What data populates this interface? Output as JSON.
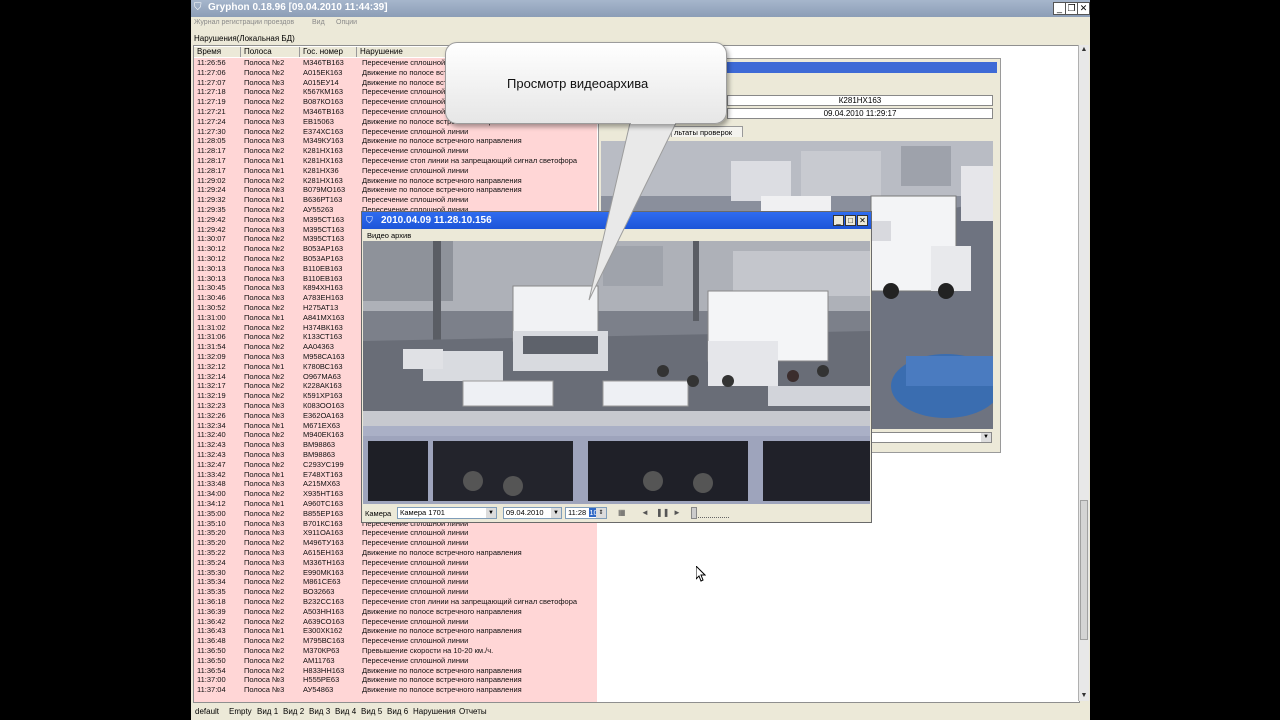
{
  "window": {
    "title": "Gryphon 0.18.96 [09.04.2010 11:44:39]",
    "controls": [
      "_",
      "❐",
      "✕"
    ]
  },
  "menu": [
    "Журнал регистрации проездов",
    "Вид",
    "Опции"
  ],
  "panel_title": "Нарушения(Локальная БД)",
  "columns": [
    "Время",
    "Полоса",
    "Гос. номер",
    "Нарушение"
  ],
  "rows": [
    [
      "11:26:56",
      "Полоса №2",
      "М346ТВ163",
      "Пересечение сплошной линии"
    ],
    [
      "11:27:06",
      "Полоса №2",
      "А015ЕК163",
      "Движение по полосе встречного направления"
    ],
    [
      "11:27:07",
      "Полоса №3",
      "А015ЕУ14",
      "Движение по полосе встречного направления"
    ],
    [
      "11:27:18",
      "Полоса №2",
      "К567КМ163",
      "Пересечение сплошной линии"
    ],
    [
      "11:27:19",
      "Полоса №2",
      "В087КО163",
      "Пересечение сплошной линии"
    ],
    [
      "11:27:21",
      "Полоса №2",
      "М346ТВ163",
      "Пересечение сплошной линии"
    ],
    [
      "11:27:24",
      "Полоса №3",
      "ЕВ15063",
      "Движение по полосе встречного направления"
    ],
    [
      "11:27:30",
      "Полоса №2",
      "Е374ХС163",
      "Пересечение сплошной линии"
    ],
    [
      "11:28:05",
      "Полоса №3",
      "М349КУ163",
      "Движение по полосе встречного направления"
    ],
    [
      "11:28:17",
      "Полоса №2",
      "К281НХ163",
      "Пересечение сплошной линии"
    ],
    [
      "11:28:17",
      "Полоса №1",
      "К281НХ163",
      "Пересечение стоп линии на запрещающий сигнал светофора"
    ],
    [
      "11:28:17",
      "Полоса №1",
      "К281НХ36",
      "Пересечение сплошной линии"
    ],
    [
      "11:29:02",
      "Полоса №2",
      "К281НХ163",
      "Движение по полосе встречного направления"
    ],
    [
      "11:29:24",
      "Полоса №3",
      "В079МО163",
      "Движение по полосе встречного направления"
    ],
    [
      "11:29:32",
      "Полоса №1",
      "В636РТ163",
      "Пересечение сплошной линии"
    ],
    [
      "11:29:35",
      "Полоса №2",
      "АУ55263",
      "Пересечение сплошной линии"
    ],
    [
      "11:29:42",
      "Полоса №3",
      "М395СТ163",
      ""
    ],
    [
      "11:29:42",
      "Полоса №3",
      "М395СТ163",
      ""
    ],
    [
      "11:30:07",
      "Полоса №2",
      "М395СТ163",
      ""
    ],
    [
      "11:30:12",
      "Полоса №2",
      "В053АР163",
      ""
    ],
    [
      "11:30:12",
      "Полоса №2",
      "В053АР163",
      ""
    ],
    [
      "11:30:13",
      "Полоса №3",
      "В110ЕВ163",
      ""
    ],
    [
      "11:30:13",
      "Полоса №3",
      "В110ЕВ163",
      ""
    ],
    [
      "11:30:45",
      "Полоса №3",
      "К894ХН163",
      ""
    ],
    [
      "11:30:46",
      "Полоса №3",
      "А783ЕН163",
      ""
    ],
    [
      "11:30:52",
      "Полоса №2",
      "Н275АТ13",
      ""
    ],
    [
      "11:31:00",
      "Полоса №1",
      "А841МХ163",
      ""
    ],
    [
      "11:31:02",
      "Полоса №2",
      "Н374ВК163",
      ""
    ],
    [
      "11:31:06",
      "Полоса №2",
      "К133СТ163",
      ""
    ],
    [
      "11:31:54",
      "Полоса №2",
      "АА04363",
      ""
    ],
    [
      "11:32:09",
      "Полоса №3",
      "М958СА163",
      ""
    ],
    [
      "11:32:12",
      "Полоса №1",
      "К780ВС163",
      ""
    ],
    [
      "11:32:14",
      "Полоса №2",
      "О967МА63",
      ""
    ],
    [
      "11:32:17",
      "Полоса №2",
      "К228АК163",
      ""
    ],
    [
      "11:32:19",
      "Полоса №2",
      "К591ХР163",
      ""
    ],
    [
      "11:32:23",
      "Полоса №3",
      "К083ОО163",
      ""
    ],
    [
      "11:32:26",
      "Полоса №3",
      "Е362ОА163",
      ""
    ],
    [
      "11:32:34",
      "Полоса №1",
      "М671ЕХ63",
      ""
    ],
    [
      "11:32:40",
      "Полоса №2",
      "М940ЕК163",
      ""
    ],
    [
      "11:32:43",
      "Полоса №3",
      "ВМ98863",
      ""
    ],
    [
      "11:32:43",
      "Полоса №3",
      "ВМ98863",
      ""
    ],
    [
      "11:32:47",
      "Полоса №2",
      "С293УС199",
      ""
    ],
    [
      "11:33:42",
      "Полоса №1",
      "Е748ХТ163",
      ""
    ],
    [
      "11:33:48",
      "Полоса №3",
      "А215МХ63",
      ""
    ],
    [
      "11:34:00",
      "Полоса №2",
      "Х935НТ163",
      ""
    ],
    [
      "11:34:12",
      "Полоса №1",
      "А960ТС163",
      ""
    ],
    [
      "11:35:00",
      "Полоса №2",
      "В855ЕР163",
      ""
    ],
    [
      "11:35:10",
      "Полоса №3",
      "В701КС163",
      "Пересечение сплошной линии"
    ],
    [
      "11:35:20",
      "Полоса №3",
      "Х911ОА163",
      "Пересечение сплошной линии"
    ],
    [
      "11:35:20",
      "Полоса №2",
      "М496ТУ163",
      "Пересечение сплошной линии"
    ],
    [
      "11:35:22",
      "Полоса №3",
      "А615ЕН163",
      "Движение по полосе встречного направления"
    ],
    [
      "11:35:24",
      "Полоса №3",
      "М336ТН163",
      "Пересечение сплошной линии"
    ],
    [
      "11:35:30",
      "Полоса №2",
      "Е990МК163",
      "Пересечение сплошной линии"
    ],
    [
      "11:35:34",
      "Полоса №2",
      "М861СЕ63",
      "Пересечение сплошной линии"
    ],
    [
      "11:35:35",
      "Полоса №2",
      "ВО32663",
      "Пересечение сплошной линии"
    ],
    [
      "11:36:18",
      "Полоса №2",
      "В232СС163",
      "Пересечение стоп линии на запрещающий сигнал светофора"
    ],
    [
      "11:36:39",
      "Полоса №2",
      "А503НН163",
      "Движение по полосе встречного направления"
    ],
    [
      "11:36:42",
      "Полоса №2",
      "А639СО163",
      "Пересечение сплошной линии"
    ],
    [
      "11:36:43",
      "Полоса №1",
      "Е300ХК162",
      "Движение по полосе встречного направления"
    ],
    [
      "11:36:48",
      "Полоса №2",
      "М795ВС163",
      "Пересечение сплошной линии"
    ],
    [
      "11:36:50",
      "Полоса №2",
      "М370КР63",
      "Превышение скорости на 10-20 км./ч."
    ],
    [
      "11:36:50",
      "Полоса №2",
      "АМ11763",
      "Пересечение сплошной линии"
    ],
    [
      "11:36:54",
      "Полоса №2",
      "Н833НН163",
      "Движение по полосе встречного направления"
    ],
    [
      "11:37:00",
      "Полоса №3",
      "Н555РЕ63",
      "Движение по полосе встречного направления"
    ],
    [
      "11:37:04",
      "Полоса №3",
      "АУ54863",
      "Движение по полосе встречного направления"
    ]
  ],
  "bottom_tabs": [
    "default",
    "Empty",
    "Вид 1",
    "Вид 2",
    "Вид 3",
    "Вид 4",
    "Вид 5",
    "Вид 6",
    "Нарушения",
    "Отчеты"
  ],
  "results_panel": {
    "plate": "К281НХ163",
    "datetime": "09.04.2010 11:29:17",
    "tab_label": "льтаты проверок"
  },
  "video_window": {
    "title": "2010.04.09 11.28.10.156",
    "subtitle": "Видео архив",
    "camera_label": "Камера",
    "camera_value": "Камера 1701",
    "date_value": "09.04.2010",
    "time_value": "11:28",
    "time_seconds": "10",
    "nav_prev": "◄",
    "nav_pause": "❚❚",
    "nav_next": "►",
    "controls": [
      "_",
      "□",
      "✕"
    ]
  },
  "callout": {
    "text": "Просмотр видеоархива"
  },
  "colors": {
    "row_bg": "#ffd6d6",
    "title_active": "#2f6cf0",
    "title_inactive": "#8c9db6"
  }
}
